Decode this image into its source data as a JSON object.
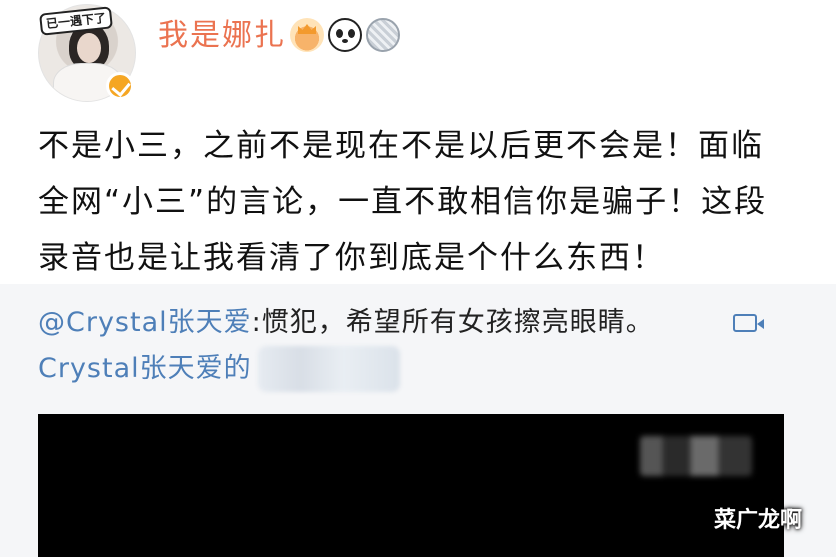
{
  "header": {
    "avatar_banner": "已一遇下了",
    "username": "我是娜扎",
    "badge_icons": [
      "crown-icon",
      "panda-icon",
      "level-icon"
    ]
  },
  "post": {
    "line1": "不是小三，之前不是现在不是以后更不会是！面临",
    "line2": "全网“小三”的言论，一直不敢相信你是骗子！这段",
    "line3": "录音也是让我看清了你到底是个什么东西！"
  },
  "repost": {
    "mention": "@Crystal张天爱",
    "text": ":惯犯，希望所有女孩擦亮眼睛。",
    "line2": "Crystal张天爱的"
  },
  "watermark": "菜广龙啊",
  "colors": {
    "username": "#eb7350",
    "link": "#4e7fb8",
    "repost_bg": "#f5f6f8",
    "video_bg": "#000000"
  }
}
